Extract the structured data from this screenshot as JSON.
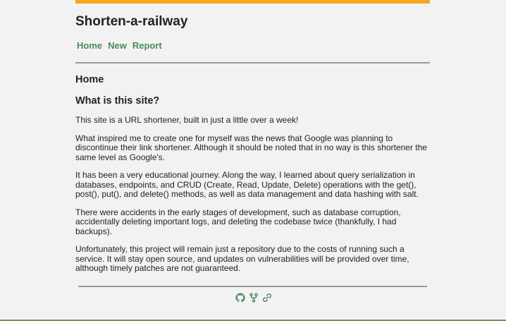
{
  "colors": {
    "accent_bar": "#f5a623",
    "nav_link": "#4a8a60",
    "icon": "#4a8a60",
    "rule": "#999999",
    "background": "#f2f2f2"
  },
  "header": {
    "site_title": "Shorten-a-railway"
  },
  "nav": {
    "items": [
      {
        "label": "Home"
      },
      {
        "label": "New"
      },
      {
        "label": "Report"
      }
    ]
  },
  "main": {
    "page_heading": "Home",
    "section_heading": "What is this site?",
    "paragraphs": [
      "This site is a URL shortener, built in just a little over a week!",
      "What inspired me to create one for myself was the news that Google was planning to discontinue their link shortener. Although it should be noted that in no way is this shortener the same level as Google's.",
      "It has been a very educational journey. Along the way, I learned about query serialization in databases, endpoints, and CRUD (Create, Read, Update, Delete) operations with the get(), post(), put(), and delete() methods, as well as data management and data hashing with salt.",
      "There were accidents in the early stages of development, such as database corruption, accidentally deleting important logs, and deleting the codebase twice (thankfully, I had backups).",
      "Unfortunately, this project will remain just a repository due to the costs of running such a service. It will stay open source, and updates on vulnerabilities will be provided over time, although timely patches are not guaranteed."
    ]
  },
  "footer": {
    "icons": [
      "github-icon",
      "fork-icon",
      "link-icon"
    ]
  }
}
